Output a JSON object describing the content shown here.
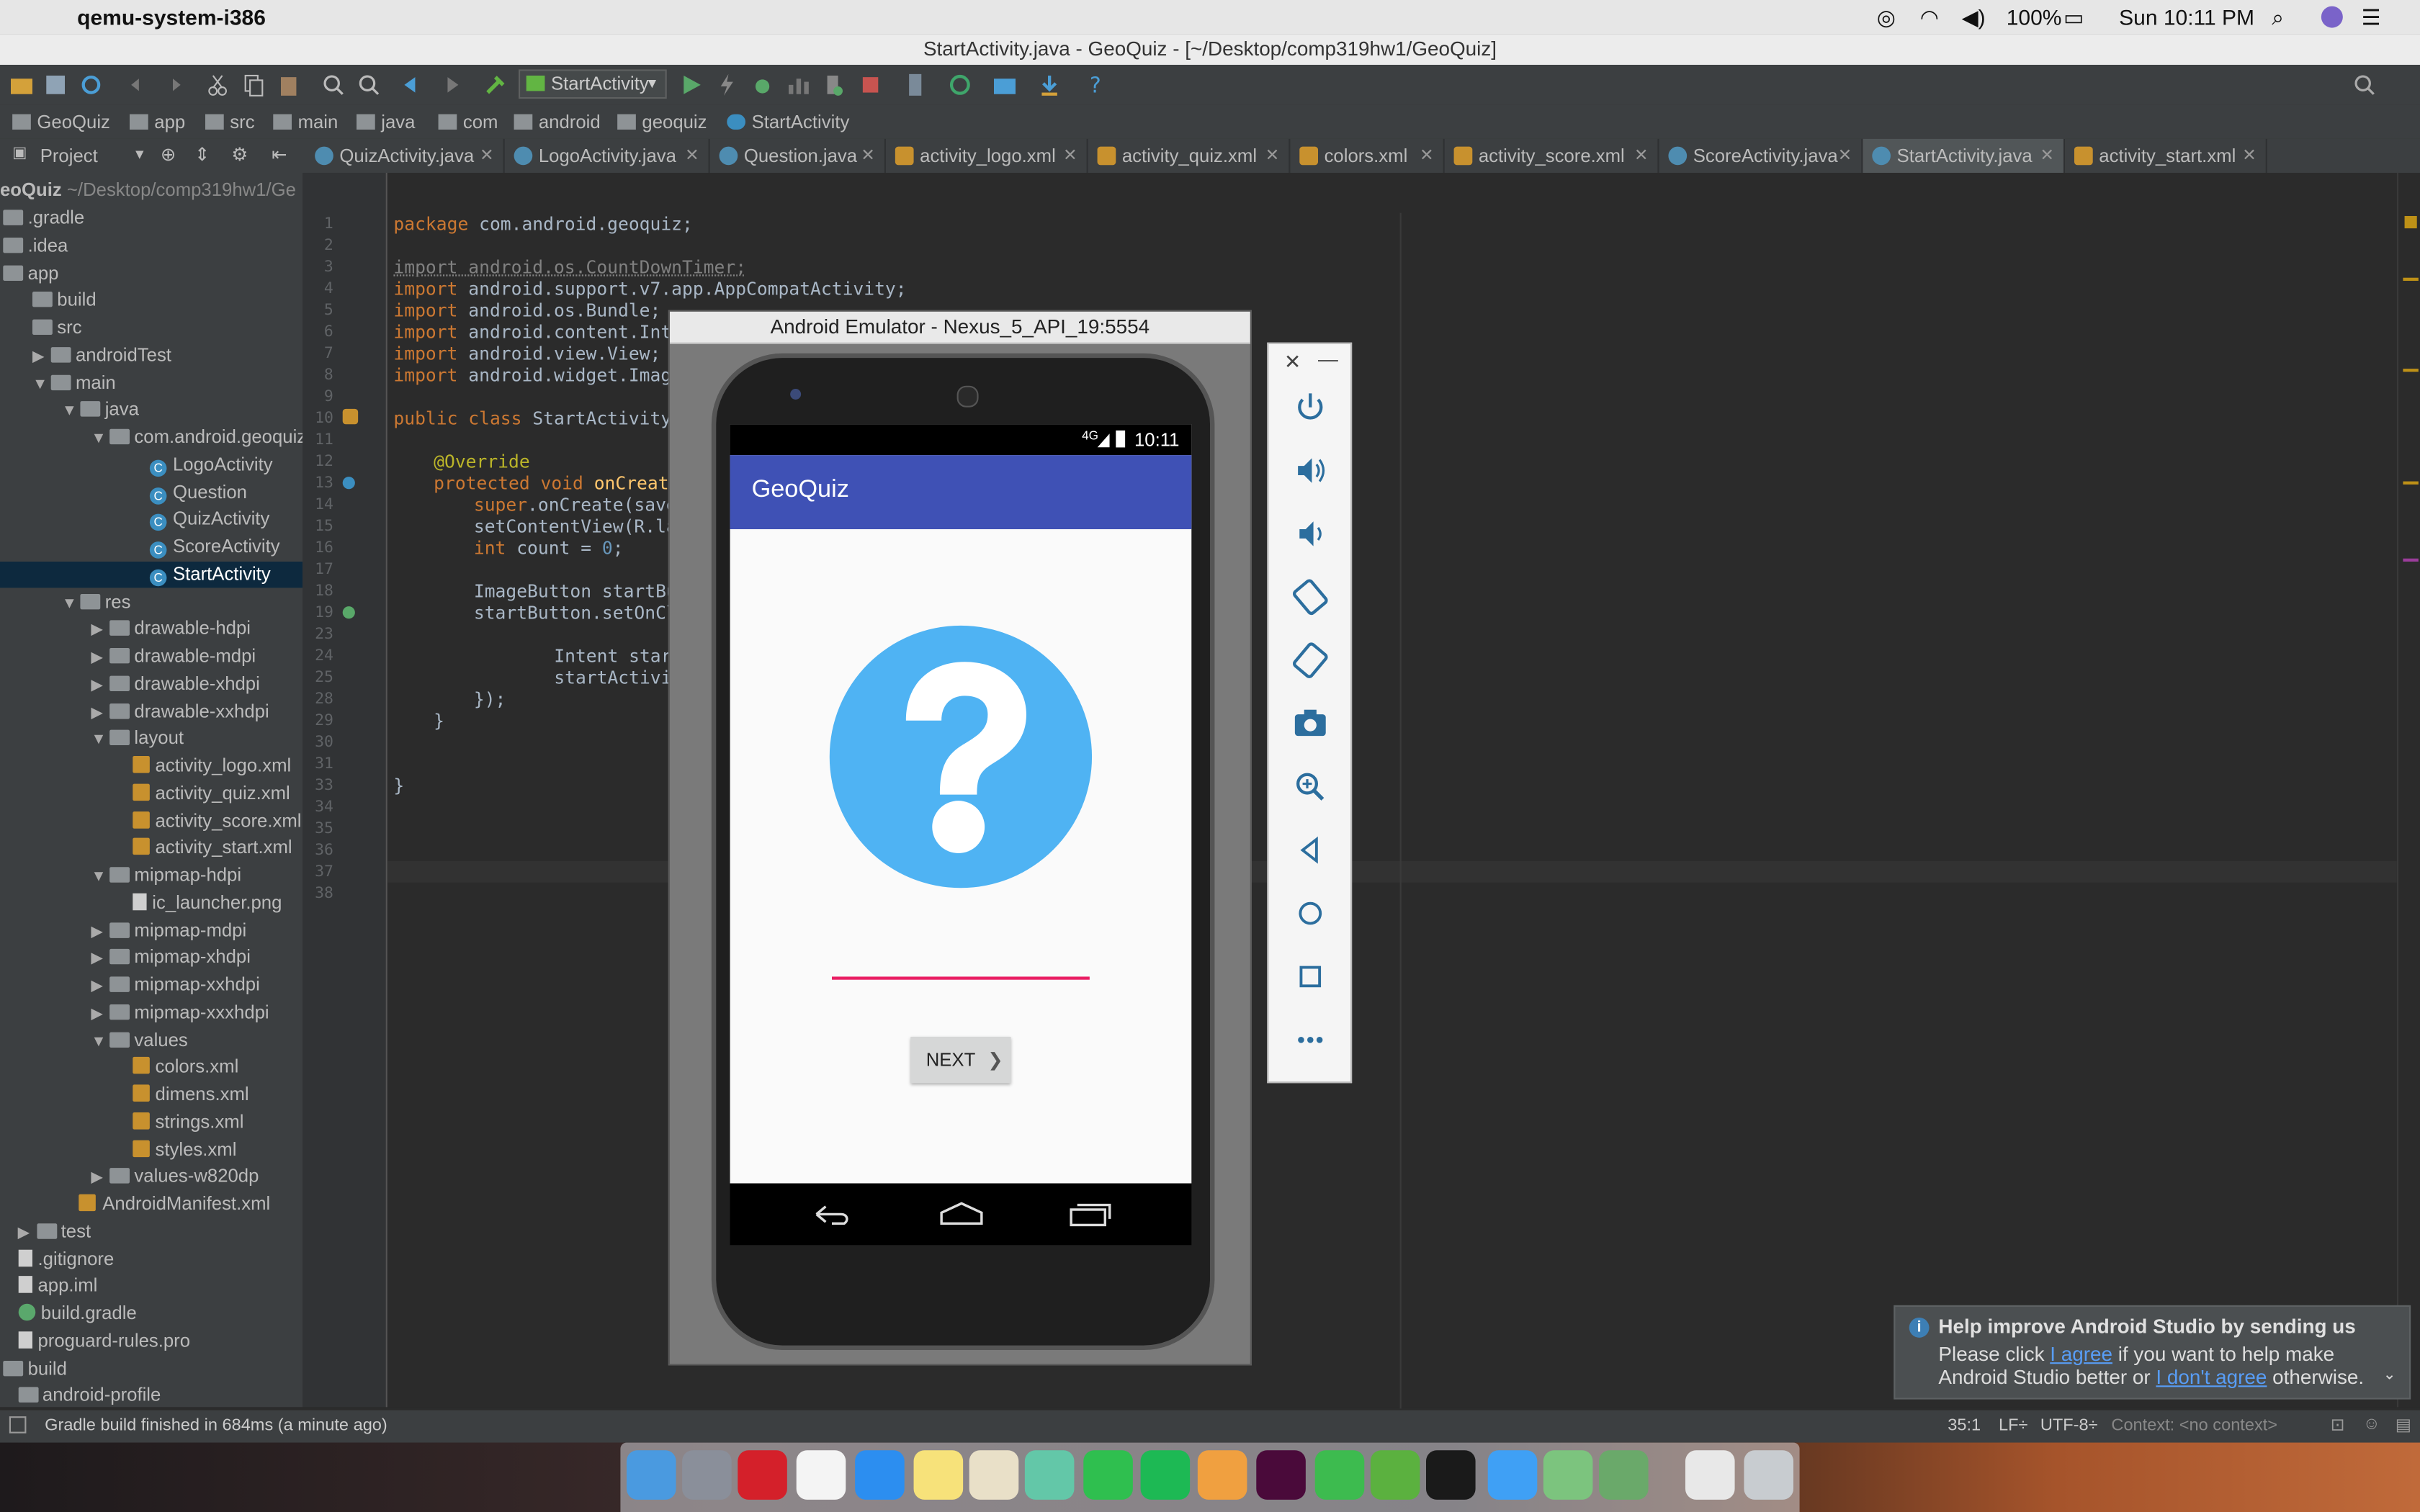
{
  "menubar": {
    "app_name": "qemu-system-i386",
    "battery": "100%",
    "clock": "Sun 10:11 PM"
  },
  "window": {
    "title": "StartActivity.java - GeoQuiz - [~/Desktop/comp319hw1/GeoQuiz]"
  },
  "toolbar": {
    "run_config": "StartActivity"
  },
  "breadcrumbs": [
    "GeoQuiz",
    "app",
    "src",
    "main",
    "java",
    "com",
    "android",
    "geoquiz",
    "StartActivity"
  ],
  "project_panel": {
    "selector_label": "Project",
    "root_label": "eoQuiz",
    "root_path": "~/Desktop/comp319hw1/Ge",
    "items": [
      ".gradle",
      ".idea",
      "app",
      "build",
      "src",
      "androidTest",
      "main",
      "java",
      "com.android.geoquiz",
      "LogoActivity",
      "Question",
      "QuizActivity",
      "ScoreActivity",
      "StartActivity",
      "res",
      "drawable-hdpi",
      "drawable-mdpi",
      "drawable-xhdpi",
      "drawable-xxhdpi",
      "layout",
      "activity_logo.xml",
      "activity_quiz.xml",
      "activity_score.xml",
      "activity_start.xml",
      "mipmap-hdpi",
      "ic_launcher.png",
      "mipmap-mdpi",
      "mipmap-xhdpi",
      "mipmap-xxhdpi",
      "mipmap-xxxhdpi",
      "values",
      "colors.xml",
      "dimens.xml",
      "strings.xml",
      "styles.xml",
      "values-w820dp",
      "AndroidManifest.xml",
      "test",
      ".gitignore",
      "app.iml",
      "build.gradle",
      "proguard-rules.pro",
      "build",
      "android-profile"
    ]
  },
  "tabs": [
    {
      "label": "QuizActivity.java",
      "type": "java"
    },
    {
      "label": "LogoActivity.java",
      "type": "java"
    },
    {
      "label": "Question.java",
      "type": "java"
    },
    {
      "label": "activity_logo.xml",
      "type": "xml"
    },
    {
      "label": "activity_quiz.xml",
      "type": "xml"
    },
    {
      "label": "colors.xml",
      "type": "xml"
    },
    {
      "label": "activity_score.xml",
      "type": "xml"
    },
    {
      "label": "ScoreActivity.java",
      "type": "java"
    },
    {
      "label": "StartActivity.java",
      "type": "java"
    },
    {
      "label": "activity_start.xml",
      "type": "xml"
    }
  ],
  "editor": {
    "line_numbers": [
      "1",
      "2",
      "3",
      "4",
      "5",
      "6",
      "7",
      "8",
      "9",
      "10",
      "11",
      "12",
      "13",
      "14",
      "15",
      "16",
      "17",
      "18",
      "19",
      "23",
      "24",
      "25",
      "28",
      "29",
      "30",
      "31",
      "33",
      "34",
      "35",
      "36",
      "37",
      "38"
    ],
    "code": {
      "l1_kw": "package",
      "l1_rest": " com.android.geoquiz;",
      "l3": "import android.os.CountDownTimer;",
      "l4_kw": "import",
      "l4_rest": " android.support.v7.app.AppCompatActivity;",
      "l5_kw": "import",
      "l5_rest": " android.os.Bundle;",
      "l6_kw": "import",
      "l6_rest": " android.content.Inte",
      "l7_kw": "import",
      "l7_rest": " android.view.View;",
      "l8_kw": "import",
      "l8_rest": " android.widget.Image",
      "l10_kw": "public class",
      "l10_rest": " StartActivity ",
      "l12": "@Override",
      "l13_kw": "protected void",
      "l13_fn": " onCreate",
      "l14_kw": "super",
      "l14_rest": ".onCreate(save",
      "l15": "setContentView(R.la",
      "l16_kw": "int",
      "l16_rest": " count = ",
      "l16_num": "0",
      "l16_end": ";",
      "l18": "ImageButton startBu",
      "l19": "startButton.setOnCl",
      "l24": "Intent star",
      "l25": "startActivi",
      "l28": "});",
      "l29": "}",
      "l31": "}"
    }
  },
  "emulator": {
    "title": "Android Emulator - Nexus_5_API_19:5554",
    "status_time": "10:11",
    "network_label": "4G",
    "app_title": "GeoQuiz",
    "next_button": "NEXT",
    "next_arrow": "❯"
  },
  "emulator_controls": [
    "close-icon",
    "minimize-icon",
    "power-icon",
    "volume-up-icon",
    "volume-down-icon",
    "rotate-left-icon",
    "rotate-right-icon",
    "camera-icon",
    "zoom-icon",
    "back-icon",
    "home-icon",
    "overview-icon",
    "more-icon"
  ],
  "notification": {
    "title": "Help improve Android Studio by sending us",
    "line1_pre": "Please click ",
    "agree_link": "I agree",
    "line1_post": " if you want to help make",
    "line2_pre": "Android Studio better or ",
    "disagree_link": "I don't agree",
    "line2_post": " otherwise."
  },
  "statusbar": {
    "message": "Gradle build finished in 684ms (a minute ago)",
    "position": "35:1",
    "line_sep": "LF÷",
    "encoding": "UTF-8÷",
    "context": "Context: <no context>"
  },
  "colors": {
    "accent_blue": "#3f51b5",
    "logo_blue": "#4fb3f3",
    "underline_pink": "#e91e63"
  }
}
